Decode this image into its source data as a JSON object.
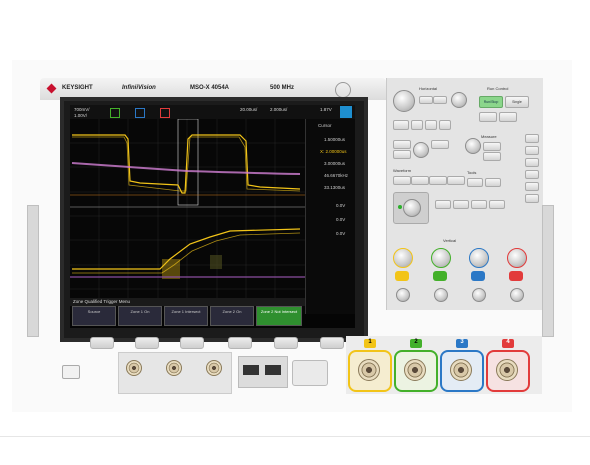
{
  "instrument": {
    "brand": "KEYSIGHT",
    "series": "InfiniiVision",
    "model": "MSO-X 4054A",
    "bandwidth": "500 MHz"
  },
  "screen": {
    "top_status": [
      "700mV/",
      "1.00V/",
      "20.00us/",
      "2.000us/",
      "1.87V"
    ],
    "side_header": "Cursor",
    "side_values": [
      "1.50000us",
      "X: 2.00000us",
      "3.00000us",
      "46.6670kHz",
      "33.1300us",
      "0.0V",
      "0.0V",
      "0.0V"
    ],
    "menu_title": "Zone Qualified Trigger Menu",
    "softkeys": [
      "Source",
      "Zone 1 On",
      "Zone 1 Intersect",
      "Zone 2 On",
      "Zone 2 Not Intersect"
    ]
  },
  "panel_labels": {
    "horizontal": "Horizontal",
    "run_control": "Run Control",
    "run_stop": "Run/Stop",
    "single": "Single",
    "measure": "Measure",
    "waveform": "Waveform",
    "tools": "Tools",
    "vertical": "Vertical"
  },
  "channels": [
    "1",
    "2",
    "3",
    "4"
  ],
  "colors": {
    "ch1": "#f2c418",
    "ch2": "#43b02a",
    "ch3": "#2b78c6",
    "ch4": "#e23b3b",
    "digital": "#d27fd4"
  }
}
